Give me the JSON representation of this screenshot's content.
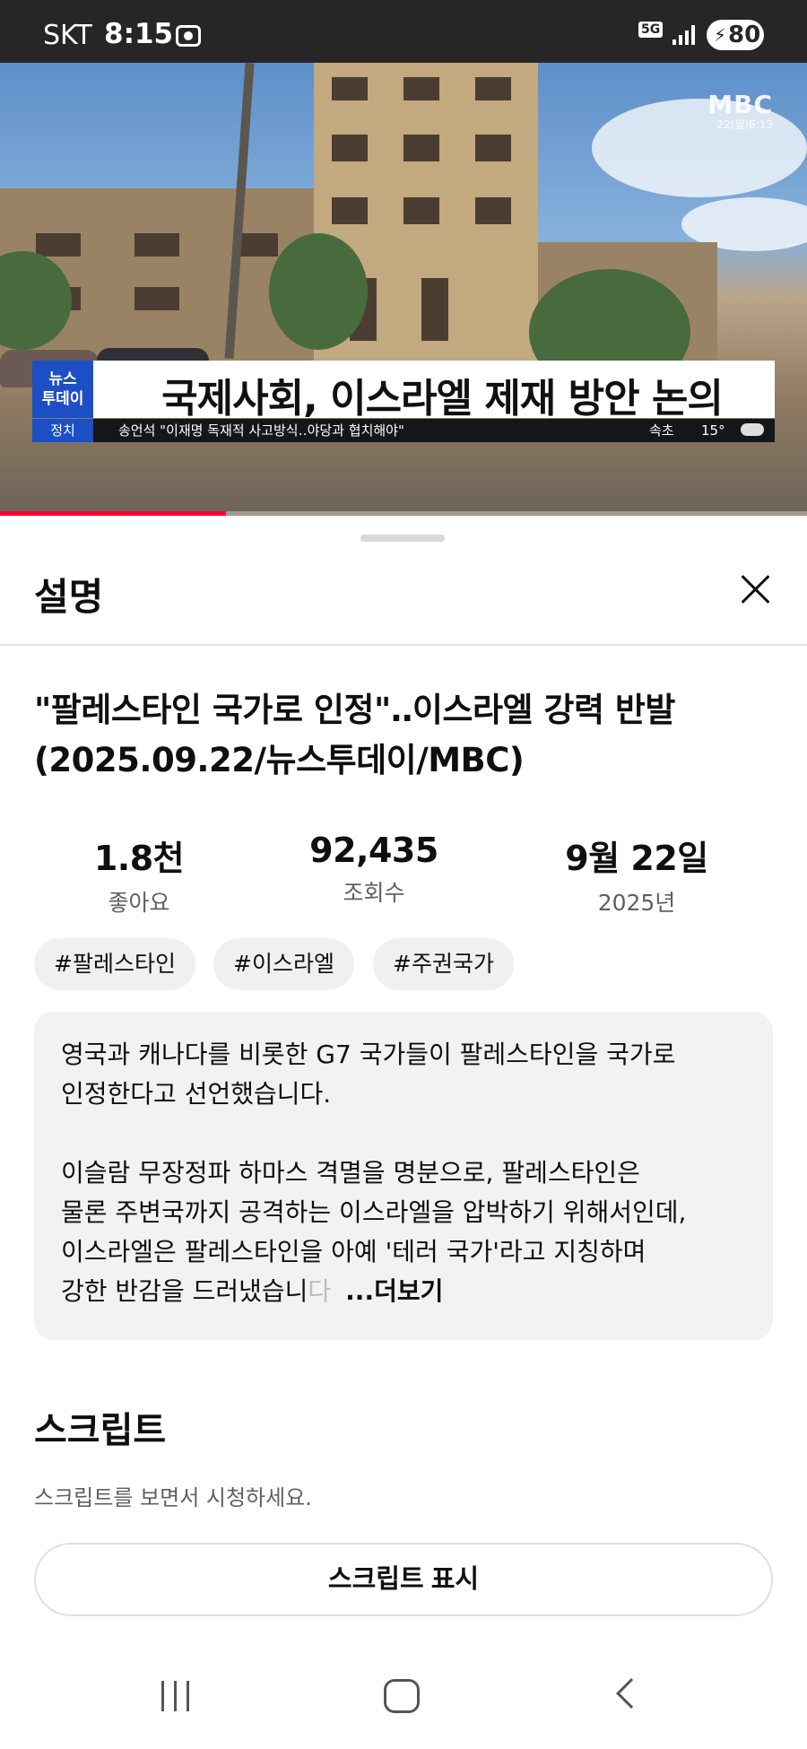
{
  "status_bar": {
    "carrier": "SKT",
    "time": "8:15",
    "network": "5G",
    "battery": "80"
  },
  "video": {
    "channel_logo": "MBC",
    "broadcast_time": "22(월)6:13",
    "program_logo_line1": "뉴스",
    "program_logo_line2": "투데이",
    "caption": "국제사회, 이스라엘 제재 방안 논의",
    "ticker_category": "정치",
    "ticker_text": "송언석 \"이재명 독재적 사고방식‥야당과 협치해야\"",
    "ticker_location": "속초",
    "ticker_temp": "15°",
    "progress": 0.28
  },
  "sheet": {
    "title": "설명",
    "video_title": "\"팔레스타인 국가로 인정\"‥이스라엘 강력 반발 (2025.09.22/뉴스투데이/MBC)",
    "stats": {
      "likes_value": "1.8천",
      "likes_label": "좋아요",
      "views_value": "92,435",
      "views_label": "조회수",
      "date_value": "9월 22일",
      "date_label": "2025년"
    },
    "tags": [
      "#팔레스타인",
      "#이스라엘",
      "#주권국가"
    ],
    "description": {
      "line1": "영국과 캐나다를 비롯한 G7 국가들이 팔레스타인을 국가로",
      "line2": "인정한다고 선언했습니다.",
      "line3": "이슬람 무장정파 하마스 격멸을 명분으로, 팔레스타인은",
      "line4": "물론 주변국까지 공격하는 이스라엘을 압박하기 위해서인데,",
      "line5": "이스라엘은 팔레스타인을 아예 '테러 국가'라고 지칭하며",
      "line6": "강한 반감을 드러냈습니",
      "line6_fade": "다",
      "more": "...더보기"
    },
    "script": {
      "title": "스크립트",
      "hint": "스크립트를 보면서 시청하세요.",
      "button": "스크립트 표시"
    }
  },
  "icons": {
    "close": "close-icon",
    "recents": "recent-apps-icon",
    "home": "home-icon",
    "back": "back-icon"
  }
}
